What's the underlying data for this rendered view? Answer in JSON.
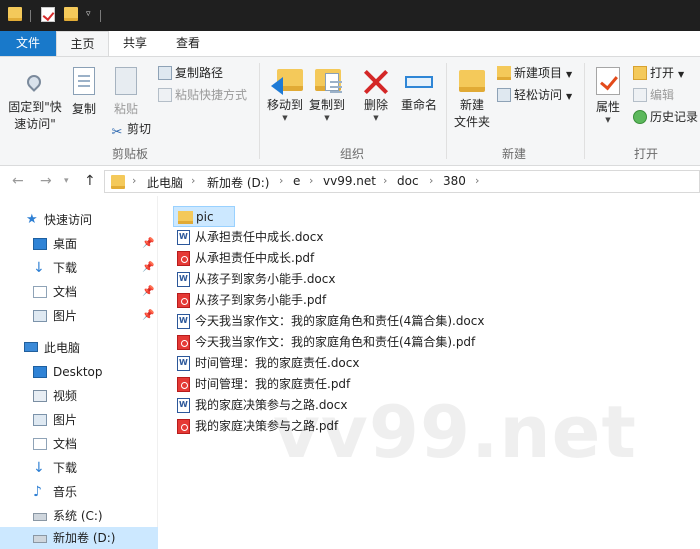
{
  "ribbon_tabs": [
    "文件",
    "主页",
    "共享",
    "查看"
  ],
  "clipboard": {
    "pin_label_line1": "固定到\"快",
    "pin_label_line2": "速访问\"",
    "copy_label": "复制",
    "paste_label": "粘贴",
    "copy_path_label": "复制路径",
    "paste_shortcut_label": "粘贴快捷方式",
    "cut_label": "剪切",
    "group_label": "剪贴板"
  },
  "organize": {
    "move_to_label": "移动到",
    "copy_to_label": "复制到",
    "delete_label": "删除",
    "rename_label": "重命名",
    "group_label": "组织"
  },
  "new_group": {
    "new_folder_line1": "新建",
    "new_folder_line2": "文件夹",
    "new_item_label": "新建项目",
    "easy_access_label": "轻松访问",
    "group_label": "新建"
  },
  "open_group": {
    "properties_label": "属性",
    "open_label": "打开",
    "edit_label": "编辑",
    "history_label": "历史记录",
    "group_label": "打开"
  },
  "address": {
    "breadcrumbs": [
      "此电脑",
      "新加卷 (D:)",
      "e",
      "vv99.net",
      "doc",
      "380"
    ]
  },
  "sidebar": {
    "quick_access_label": "快速访问",
    "quick_items": [
      {
        "label": "桌面",
        "icon": "desktop-icon",
        "pinned": true
      },
      {
        "label": "下载",
        "icon": "download-icon",
        "pinned": true
      },
      {
        "label": "文档",
        "icon": "documents-icon",
        "pinned": true
      },
      {
        "label": "图片",
        "icon": "pictures-icon",
        "pinned": true
      }
    ],
    "this_pc_label": "此电脑",
    "pc_items": [
      {
        "label": "Desktop",
        "icon": "desktop-icon"
      },
      {
        "label": "视频",
        "icon": "video-icon"
      },
      {
        "label": "图片",
        "icon": "pictures-icon"
      },
      {
        "label": "文档",
        "icon": "documents-icon"
      },
      {
        "label": "下载",
        "icon": "download-icon"
      },
      {
        "label": "音乐",
        "icon": "music-icon"
      },
      {
        "label": "系统 (C:)",
        "icon": "drive-icon"
      },
      {
        "label": "新加卷 (D:)",
        "icon": "drive-icon"
      }
    ]
  },
  "files": [
    {
      "name": "pic",
      "type": "folder"
    },
    {
      "name": "从承担责任中成长.docx",
      "type": "docx"
    },
    {
      "name": "从承担责任中成长.pdf",
      "type": "pdf"
    },
    {
      "name": "从孩子到家务小能手.docx",
      "type": "docx"
    },
    {
      "name": "从孩子到家务小能手.pdf",
      "type": "pdf"
    },
    {
      "name": "今天我当家作文：我的家庭角色和责任(4篇合集).docx",
      "type": "docx"
    },
    {
      "name": "今天我当家作文：我的家庭角色和责任(4篇合集).pdf",
      "type": "pdf"
    },
    {
      "name": "时间管理：我的家庭责任.docx",
      "type": "docx"
    },
    {
      "name": "时间管理：我的家庭责任.pdf",
      "type": "pdf"
    },
    {
      "name": "我的家庭决策参与之路.docx",
      "type": "docx"
    },
    {
      "name": "我的家庭决策参与之路.pdf",
      "type": "pdf"
    }
  ],
  "watermark": "vv99.net",
  "colors": {
    "file_tab": "#1979ca",
    "selection": "#cce8ff",
    "folder": "#f4c95a",
    "pdf": "#e53935",
    "docx": "#2b579a"
  }
}
